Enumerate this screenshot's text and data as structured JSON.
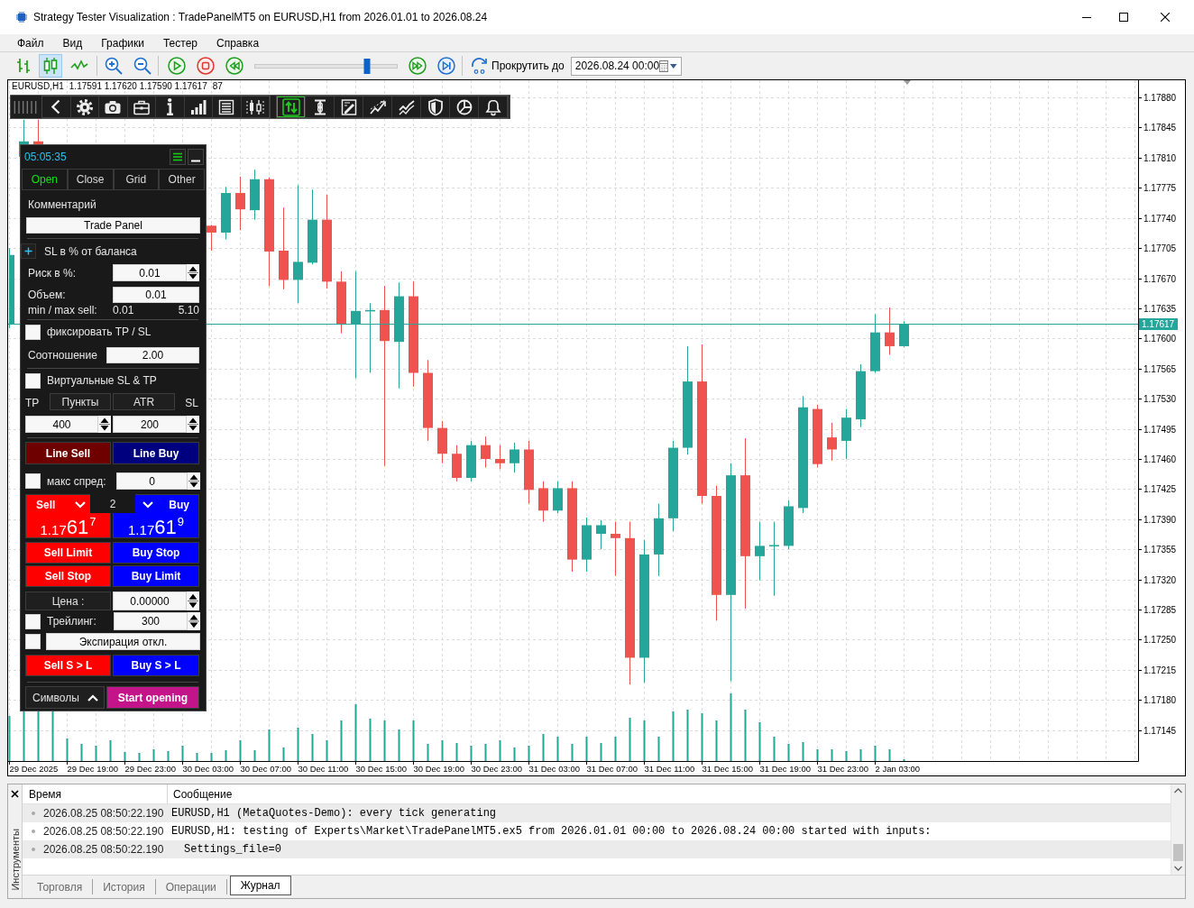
{
  "window": {
    "title": "Strategy Tester Visualization : TradePanelMT5 on EURUSD,H1 from 2026.01.01 to 2026.08.24"
  },
  "menu": [
    "Файл",
    "Вид",
    "Графики",
    "Тестер",
    "Справка"
  ],
  "toolbar": {
    "chart_types": [
      {
        "selected": false
      },
      {
        "selected": true
      },
      {
        "selected": false
      }
    ],
    "speed": {
      "level": 0.79
    },
    "scroll_label": "Прокрутить до",
    "scroll_date": "2026.08.24 00:00"
  },
  "chart": {
    "header": {
      "symbol": "EURUSD,H1",
      "ohlc": "1.17591 1.17620 1.17590 1.17617",
      "volume": "87"
    },
    "tools": [
      {
        "selected": false
      },
      {
        "selected": false
      },
      {
        "selected": false
      },
      {
        "selected": false
      },
      {
        "selected": false
      },
      {
        "selected": false
      },
      {
        "selected": false
      },
      {
        "selected": false
      },
      {
        "selected": true
      },
      {
        "selected": false
      },
      {
        "selected": false
      },
      {
        "selected": false
      },
      {
        "selected": false
      },
      {
        "selected": false
      },
      {
        "selected": false
      },
      {
        "selected": false
      }
    ],
    "price_axis": [
      "1.17880",
      "1.17845",
      "1.17810",
      "1.17775",
      "1.17740",
      "1.17705",
      "1.17670",
      "1.17635",
      "1.17600",
      "1.17565",
      "1.17530",
      "1.17495",
      "1.17460",
      "1.17425",
      "1.17390",
      "1.17355",
      "1.17320",
      "1.17285",
      "1.17250",
      "1.17215",
      "1.17180",
      "1.17145"
    ],
    "current_price": "1.17617",
    "time_axis": [
      "29 Dec 2025",
      "29 Dec 19:00",
      "29 Dec 23:00",
      "30 Dec 03:00",
      "30 Dec 07:00",
      "30 Dec 11:00",
      "30 Dec 15:00",
      "30 Dec 19:00",
      "30 Dec 23:00",
      "31 Dec 03:00",
      "31 Dec 07:00",
      "31 Dec 11:00",
      "31 Dec 15:00",
      "31 Dec 19:00",
      "31 Dec 23:00",
      "2 Jan 03:00"
    ]
  },
  "trade_panel": {
    "clock": "05:05:35",
    "tabs": [
      {
        "label": "Open",
        "selected": true
      },
      {
        "label": "Close",
        "selected": false
      },
      {
        "label": "Grid",
        "selected": false
      },
      {
        "label": "Other",
        "selected": false
      }
    ],
    "comment_label": "Комментарий",
    "comment": "Trade Panel",
    "sl_mode": "SL в % от баланса",
    "risk": {
      "label": "Риск в %:",
      "value": "0.01"
    },
    "volume": {
      "label": "Объем:",
      "value": "0.01"
    },
    "min_max": {
      "label": "min / max sell:",
      "min": "0.01",
      "max": "5.10"
    },
    "fix_tp_sl": {
      "label": "фиксировать TP / SL",
      "checked": false
    },
    "ratio": {
      "label": "Соотношение",
      "value": "2.00"
    },
    "virtual": {
      "label": "Виртуальные SL & TP",
      "checked": false
    },
    "tp_label": "TP",
    "modes": [
      "Пункты",
      "ATR"
    ],
    "sl_label": "SL",
    "tp": "400",
    "sl": "200",
    "line_sell": "Line Sell",
    "line_buy": "Line Buy",
    "max_spread": {
      "label": "макс спред:",
      "checked": false,
      "value": "0"
    },
    "sell": {
      "label": "Sell",
      "price_head": "1.17",
      "price_big": "61",
      "price_tail": "7"
    },
    "spread": "2",
    "buy": {
      "label": "Buy",
      "price_head": "1.17",
      "price_big": "61",
      "price_tail": "9"
    },
    "orders": [
      {
        "sell": "Sell Limit",
        "buy": "Buy Stop"
      },
      {
        "sell": "Sell Stop",
        "buy": "Buy Limit"
      }
    ],
    "price": {
      "label": "Цена :",
      "value": "0.00000"
    },
    "trailing": {
      "label": "Трейлинг:",
      "checked": false,
      "value": "300"
    },
    "expiration": {
      "checked": false,
      "value": "Экспирация откл."
    },
    "stop_limit": {
      "sell": "Sell S > L",
      "buy": "Buy S > L"
    },
    "symbols": "Символы",
    "start": "Start opening"
  },
  "log": {
    "side_label": "Инструменты",
    "columns": [
      "Время",
      "Сообщение"
    ],
    "rows": [
      {
        "kind": "event",
        "time": "2026.08.25 08:50:22.190",
        "message": "EURUSD,H1 (MetaQuotes-Demo): every tick generating"
      },
      {
        "kind": "event",
        "time": "2026.08.25 08:50:22.190",
        "message": "EURUSD,H1: testing of Experts\\Market\\TradePanelMT5.ex5 from 2026.01.01 00:00 to 2026.08.24 00:00 started with inputs:"
      },
      {
        "kind": "parameter",
        "time": "2026.08.25 08:50:22.190",
        "message": "Settings_file=0"
      }
    ],
    "tabs": [
      {
        "label": "Торговля",
        "selected": false
      },
      {
        "label": "История",
        "selected": false
      },
      {
        "label": "Операции",
        "selected": false
      },
      {
        "label": "Журнал",
        "selected": true
      }
    ]
  }
}
